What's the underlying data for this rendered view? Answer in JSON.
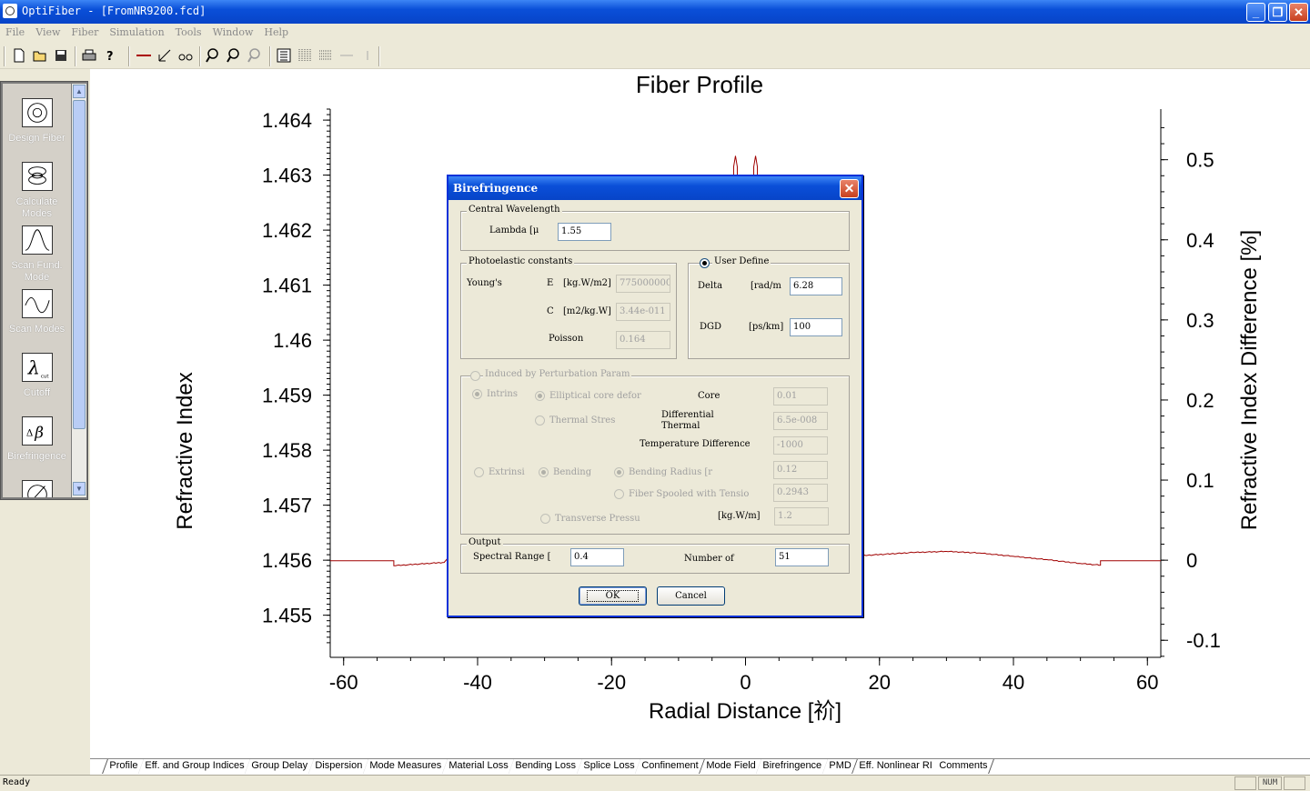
{
  "window": {
    "title": "OptiFiber  - [FromNR9200.fcd]",
    "minimize_label": "_",
    "restore_label": "❐",
    "close_label": "✕"
  },
  "menu": [
    "File",
    "View",
    "Fiber",
    "Simulation",
    "Tools",
    "Window",
    "Help"
  ],
  "toolbar_icons": [
    "new-file-icon",
    "open-folder-icon",
    "save-icon",
    "print-icon",
    "help-icon",
    "line-icon",
    "axis-icon",
    "glasses-icon",
    "zoom-in-icon",
    "zoom-icon",
    "zoom-out-icon",
    "table-icon",
    "columns-icon",
    "rows-icon",
    "dash-icon",
    "mark-icon"
  ],
  "left_panel": [
    {
      "label": "Design Fiber",
      "icon": "design-fiber-icon"
    },
    {
      "label": "Calculate Modes",
      "icon": "calculate-modes-icon"
    },
    {
      "label": "Scan Fund. Mode",
      "icon": "scan-fund-mode-icon"
    },
    {
      "label": "Scan Modes",
      "icon": "scan-modes-icon"
    },
    {
      "label": "Cutoff",
      "icon": "cutoff-icon"
    },
    {
      "label": "Birefringence",
      "icon": "birefringence-icon"
    }
  ],
  "colors": {
    "curve": "#a00000",
    "titlebar": "#0a4fd8"
  },
  "chart_data": {
    "type": "line",
    "title": "Fiber Profile",
    "xlabel": "Radial Distance [祄]",
    "ylabel": "Refractive Index",
    "y2label": "Refractive Index Difference [%]",
    "x_ticks": [
      "-60",
      "-40",
      "-20",
      "0",
      "20",
      "40",
      "60"
    ],
    "y_ticks": [
      "1.464",
      "1.463",
      "1.462",
      "1.461",
      "1.46",
      "1.459",
      "1.458",
      "1.457",
      "1.456",
      "1.455"
    ],
    "y2_ticks": [
      "0.5",
      "0.4",
      "0.3",
      "0.2",
      "0.1",
      "0",
      "-0.1"
    ],
    "xlim": [
      -62,
      62
    ],
    "ylim": [
      1.4543,
      1.4642
    ],
    "series": [
      {
        "x": [
          -62,
          -52.5,
          -52.5,
          -45,
          -45,
          3,
          3,
          17,
          17,
          25,
          30,
          35,
          40,
          45,
          50,
          53,
          53,
          62
        ],
        "y": [
          1.45599,
          1.45599,
          1.4559,
          1.45596,
          1.45596,
          1.46286,
          1.456,
          1.456,
          1.45608,
          1.45614,
          1.45616,
          1.45613,
          1.45607,
          1.45601,
          1.45594,
          1.45591,
          1.45599,
          1.45599
        ]
      }
    ],
    "spikes_x": [
      -1.5,
      1.5
    ],
    "spike_y": 1.46335
  },
  "dialog": {
    "title": "Birefringence",
    "close_label": "✕",
    "central": {
      "group": "Central Wavelength",
      "lambda_label": "Lambda [μ",
      "lambda_value": "1.55"
    },
    "photo": {
      "group": "Photoelastic constants",
      "youngs_label": "Young's",
      "e_label": "E",
      "e_unit": "[kg.W/m2]",
      "e_value": "775000000",
      "c_label": "C",
      "c_unit": "[m2/kg.W]",
      "c_value": "3.44e-011",
      "poisson_label": "Poisson",
      "poisson_value": "0.164"
    },
    "user": {
      "group": "User Define",
      "delta_label": "Delta",
      "delta_unit": "[rad/m",
      "delta_value": "6.28",
      "dgd_label": "DGD",
      "dgd_unit": "[ps/km]",
      "dgd_value": "100"
    },
    "perturb": {
      "group": "Induced by Perturbation Param",
      "intrinsic": "Intrins",
      "elliptical": "Elliptical core defor",
      "core_label": "Core",
      "core_value": "0.01",
      "thermal": "Thermal Stres",
      "diff_thermal_1": "Differential",
      "diff_thermal_2": "Thermal",
      "diff_thermal_value": "6.5e-008",
      "temp_diff_label": "Temperature Difference",
      "temp_diff_value": "-1000",
      "extrinsic": "Extrinsi",
      "bending": "Bending",
      "bending_radius": "Bending Radius [r",
      "bending_radius_value": "0.12",
      "spooled": "Fiber Spooled with Tensio",
      "spooled_value": "0.2943",
      "transverse": "Transverse Pressu",
      "transverse_unit": "[kg.W/m]",
      "transverse_value": "1.2"
    },
    "output": {
      "group": "Output",
      "spectral_label": "Spectral Range [",
      "spectral_value": "0.4",
      "number_label": "Number of",
      "number_value": "51"
    },
    "ok_label": "OK",
    "cancel_label": "Cancel"
  },
  "tabs": [
    "Profile",
    "Eff. and Group Indices",
    "Group Delay",
    "Dispersion",
    "Mode Measures",
    "Material Loss",
    "Bending Loss",
    "Splice Loss",
    "Confinement",
    "Mode Field",
    "Birefringence",
    "PMD",
    "Eff. Nonlinear RI",
    "Comments"
  ],
  "status": {
    "text": "Ready",
    "num": "NUM"
  }
}
